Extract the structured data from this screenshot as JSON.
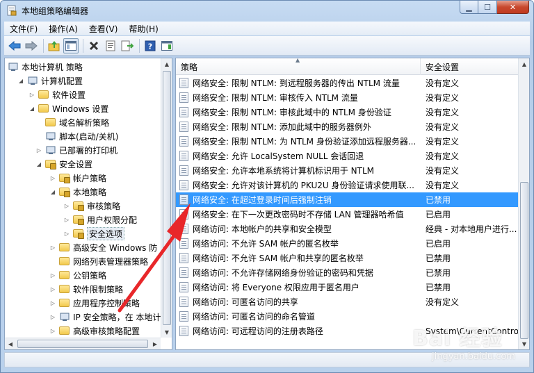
{
  "window": {
    "title": "本地组策略编辑器"
  },
  "menu": [
    "文件(F)",
    "操作(A)",
    "查看(V)",
    "帮助(H)"
  ],
  "tree": [
    {
      "label": "本地计算机 策略",
      "icon": "computer-policy-icon",
      "expander": "",
      "level": 0
    },
    {
      "label": "计算机配置",
      "icon": "computer-icon",
      "expander": "open",
      "level": 1
    },
    {
      "label": "软件设置",
      "icon": "folder-icon",
      "expander": "closed",
      "level": 2
    },
    {
      "label": "Windows 设置",
      "icon": "folder-icon",
      "expander": "open",
      "level": 2
    },
    {
      "label": "域名解析策略",
      "icon": "folder-icon",
      "expander": "",
      "level": 3
    },
    {
      "label": "脚本(启动/关机)",
      "icon": "script-icon",
      "expander": "",
      "level": 3
    },
    {
      "label": "已部署的打印机",
      "icon": "printer-icon",
      "expander": "closed",
      "level": 3
    },
    {
      "label": "安全设置",
      "icon": "security-folder-icon",
      "expander": "open",
      "level": 3
    },
    {
      "label": "帐户策略",
      "icon": "security-folder-icon",
      "expander": "closed",
      "level": 4
    },
    {
      "label": "本地策略",
      "icon": "security-folder-icon",
      "expander": "open",
      "level": 4
    },
    {
      "label": "审核策略",
      "icon": "security-folder-icon",
      "expander": "closed",
      "level": 5
    },
    {
      "label": "用户权限分配",
      "icon": "security-folder-icon",
      "expander": "closed",
      "level": 5
    },
    {
      "label": "安全选项",
      "icon": "security-folder-icon",
      "expander": "closed",
      "level": 5,
      "selected": true
    },
    {
      "label": "高级安全 Windows 防",
      "icon": "folder-icon",
      "expander": "closed",
      "level": 4
    },
    {
      "label": "网络列表管理器策略",
      "icon": "folder-icon",
      "expander": "",
      "level": 4
    },
    {
      "label": "公钥策略",
      "icon": "folder-icon",
      "expander": "closed",
      "level": 4
    },
    {
      "label": "软件限制策略",
      "icon": "folder-icon",
      "expander": "closed",
      "level": 4
    },
    {
      "label": "应用程序控制策略",
      "icon": "folder-icon",
      "expander": "closed",
      "level": 4
    },
    {
      "label": "IP 安全策略，在 本地计",
      "icon": "ip-security-icon",
      "expander": "closed",
      "level": 4
    },
    {
      "label": "高级审核策略配置",
      "icon": "folder-icon",
      "expander": "closed",
      "level": 4
    }
  ],
  "columns": {
    "policy": "策略",
    "setting": "安全设置"
  },
  "rows": [
    {
      "policy": "网络安全: 限制 NTLM: 到远程服务器的传出 NTLM 流量",
      "setting": "没有定义"
    },
    {
      "policy": "网络安全: 限制 NTLM: 审核传入 NTLM 流量",
      "setting": "没有定义"
    },
    {
      "policy": "网络安全: 限制 NTLM: 审核此域中的 NTLM 身份验证",
      "setting": "没有定义"
    },
    {
      "policy": "网络安全: 限制 NTLM: 添加此域中的服务器例外",
      "setting": "没有定义"
    },
    {
      "policy": "网络安全: 限制 NTLM: 为 NTLM 身份验证添加远程服务器...",
      "setting": "没有定义"
    },
    {
      "policy": "网络安全: 允许 LocalSystem NULL 会话回退",
      "setting": "没有定义"
    },
    {
      "policy": "网络安全: 允许本地系统将计算机标识用于 NTLM",
      "setting": "没有定义"
    },
    {
      "policy": "网络安全: 允许对该计算机的 PKU2U 身份验证请求使用联...",
      "setting": "没有定义"
    },
    {
      "policy": "网络安全: 在超过登录时间后强制注销",
      "setting": "已禁用",
      "selected": true
    },
    {
      "policy": "网络安全: 在下一次更改密码时不存储 LAN 管理器哈希值",
      "setting": "已启用"
    },
    {
      "policy": "网络访问: 本地帐户的共享和安全模型",
      "setting": "经典 - 对本地用户进行..."
    },
    {
      "policy": "网络访问: 不允许 SAM 帐户的匿名枚举",
      "setting": "已启用"
    },
    {
      "policy": "网络访问: 不允许 SAM 帐户和共享的匿名枚举",
      "setting": "已禁用"
    },
    {
      "policy": "网络访问: 不允许存储网络身份验证的密码和凭据",
      "setting": "已禁用"
    },
    {
      "policy": "网络访问: 将 Everyone 权限应用于匿名用户",
      "setting": "已禁用"
    },
    {
      "policy": "网络访问: 可匿名访问的共享",
      "setting": "没有定义"
    },
    {
      "policy": "网络访问: 可匿名访问的命名管道",
      "setting": ""
    },
    {
      "policy": "网络访问: 可远程访问的注册表路径",
      "setting": "System\\CurrentContro..."
    }
  ],
  "watermark": {
    "main": "Bai 经验",
    "sub": "jingyan.baidu.com"
  },
  "colors": {
    "selection": "#3399ff",
    "annotation_arrow": "#e8272a"
  }
}
